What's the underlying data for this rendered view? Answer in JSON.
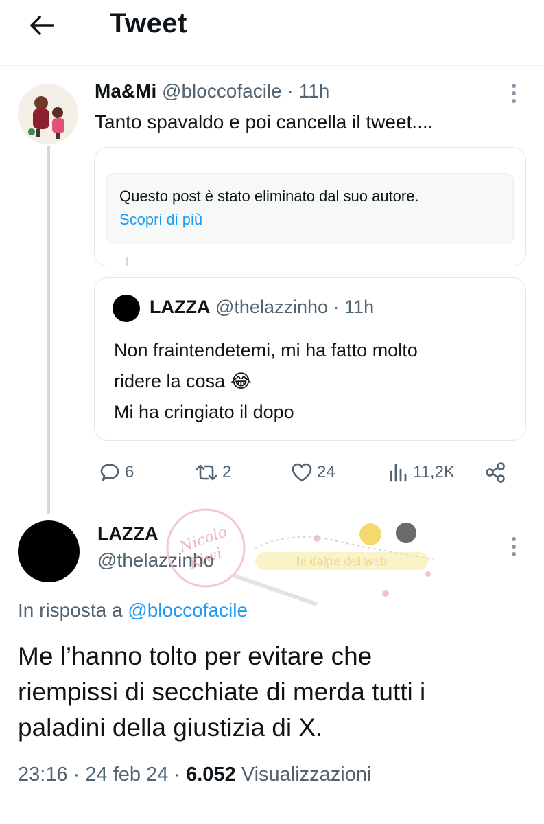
{
  "header": {
    "title": "Tweet"
  },
  "tweet1": {
    "name": "Ma&Mi",
    "handle": "@bloccofacile",
    "separator": "·",
    "time": "11h",
    "text": "Tanto spavaldo e poi cancella il tweet....",
    "deleted_notice": "Questo post è stato eliminato dal suo autore.",
    "learn_more": "Scopri di più"
  },
  "quote": {
    "name": "LAZZA",
    "handle": "@thelazzinho",
    "separator": "·",
    "time": "11h",
    "lines": [
      "Non fraintendetemi, mi ha fatto molto",
      "ridere la cosa 😂",
      "Mi ha cringiato il dopo"
    ]
  },
  "actions": {
    "replies": "6",
    "retweets": "2",
    "likes": "24",
    "views": "11,2K"
  },
  "tweet2": {
    "name": "LAZZA",
    "handle": "@thelazzinho",
    "reply_prefix": "In risposta a",
    "reply_mention": "@bloccofacile",
    "lines": [
      "Me l’hanno tolto per evitare che",
      "riempissi di secchiate di merda tutti i",
      "paladini della giustizia di X."
    ],
    "time": "23:16",
    "separator": "·",
    "date": "24 feb 24",
    "views_count": "6.052",
    "views_label": "Visualizzazioni"
  },
  "watermark": {
    "stamp_text": "Nicolo Kiwi",
    "banner_text": "le dalpe del web"
  },
  "colors": {
    "accent": "#1d9bf0",
    "secondary": "#536471",
    "text": "#0f1419",
    "border": "#e1e8ed"
  },
  "icons": [
    "back-arrow-icon",
    "more-vertical-icon",
    "reply-icon",
    "retweet-icon",
    "like-icon",
    "views-icon",
    "share-icon"
  ]
}
